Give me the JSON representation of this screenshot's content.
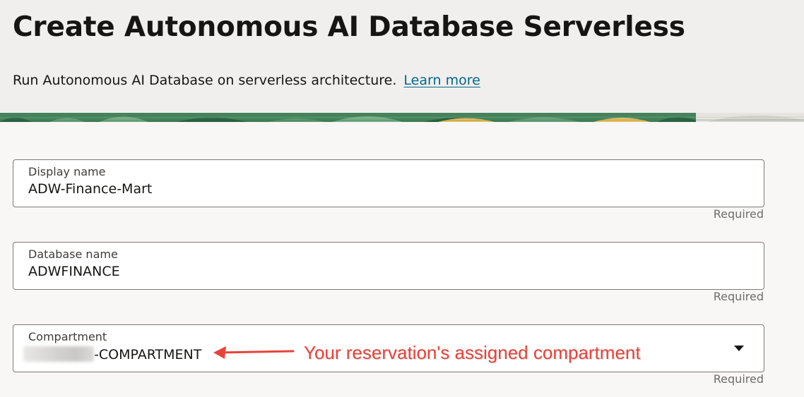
{
  "header": {
    "title": "Create Autonomous AI Database Serverless",
    "subtitle": "Run Autonomous AI Database on serverless architecture.",
    "learn_more": "Learn more"
  },
  "form": {
    "display_name": {
      "label": "Display name",
      "value": "ADW-Finance-Mart",
      "required_text": "Required"
    },
    "database_name": {
      "label": "Database name",
      "value": "ADWFINANCE",
      "required_text": "Required"
    },
    "compartment": {
      "label": "Compartment",
      "value_suffix": "-COMPARTMENT",
      "required_text": "Required"
    }
  },
  "annotation": {
    "text": "Your reservation's assigned compartment",
    "color": "#e8433b"
  },
  "colors": {
    "link": "#00688c",
    "header_bg": "#f1efed",
    "page_bg": "#f8f7f5",
    "banner_green": "#2f6e4a"
  }
}
